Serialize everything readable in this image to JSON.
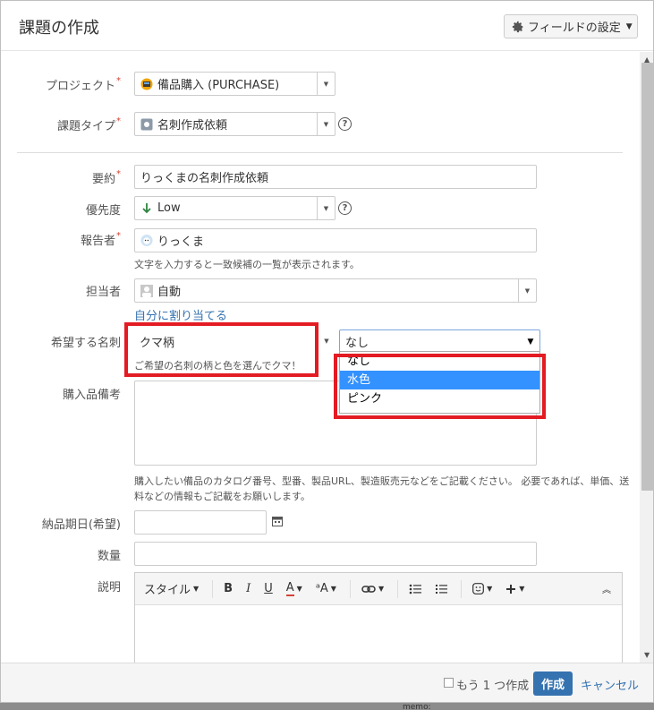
{
  "header": {
    "title": "課題の作成",
    "field_config": "フィールドの設定"
  },
  "form": {
    "project": {
      "label": "プロジェクト",
      "value": "備品購入 (PURCHASE)"
    },
    "issue_type": {
      "label": "課題タイプ",
      "value": "名刺作成依頼"
    },
    "summary": {
      "label": "要約",
      "value": "りっくまの名刺作成依頼"
    },
    "priority": {
      "label": "優先度",
      "value": "Low"
    },
    "reporter": {
      "label": "報告者",
      "value": "りっくま",
      "hint": "文字を入力すると一致候補の一覧が表示されます。"
    },
    "assignee": {
      "label": "担当者",
      "value": "自動",
      "assign_me": "自分に割り当てる"
    },
    "card": {
      "label": "希望する名刺",
      "pattern_value": "クマ柄",
      "color_value": "なし",
      "hint": "ご希望の名刺の柄と色を選んでクマ！",
      "options": [
        "なし",
        "水色",
        "ピンク"
      ],
      "selected_index": 1
    },
    "notes": {
      "label": "購入品備考",
      "hint_line1": "購入したい備品のカタログ番号、型番、製品URL、製造販売元などをご記載ください。 必要であれば、単価、送",
      "hint_line2": "料などの情報もご記載をお願いします。"
    },
    "due_date": {
      "label": "納品期日(希望)"
    },
    "quantity": {
      "label": "数量"
    },
    "description": {
      "label": "説明",
      "toolbar": {
        "style": "スタイル",
        "bold": "B",
        "italic": "I",
        "underline": "U",
        "color": "A",
        "font_size": "ᵃA"
      }
    }
  },
  "footer": {
    "create_another": "もう 1 つ作成",
    "create": "作成",
    "cancel": "キャンセル"
  },
  "background": {
    "memo": "memo:"
  },
  "colors": {
    "link": "#3572b0",
    "highlight": "#e31b23",
    "selected": "#3392ff",
    "required": "#d04437"
  }
}
